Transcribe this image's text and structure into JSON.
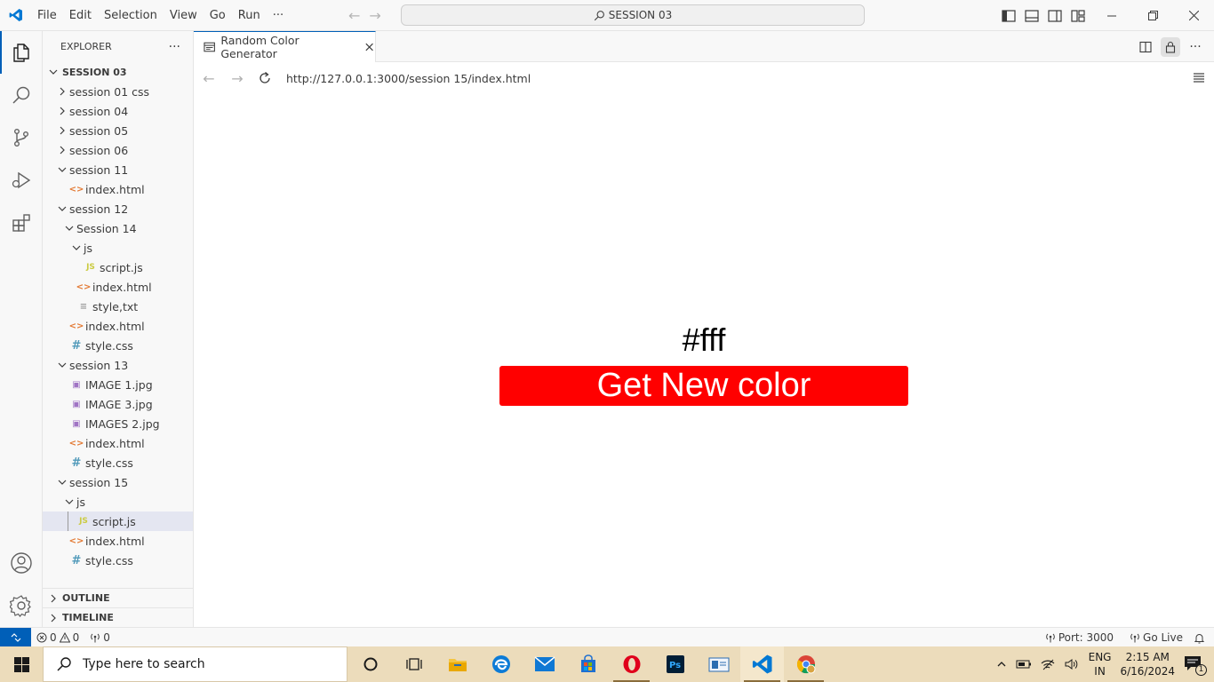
{
  "titlebar": {
    "menu": [
      "File",
      "Edit",
      "Selection",
      "View",
      "Go",
      "Run",
      "···"
    ],
    "command_center": "SESSION 03"
  },
  "sidebar": {
    "title": "EXPLORER",
    "more": "···",
    "section": "SESSION 03",
    "tree": [
      {
        "label": "session  01 css",
        "type": "folder",
        "depth": 0,
        "expanded": false
      },
      {
        "label": "session 04",
        "type": "folder",
        "depth": 0,
        "expanded": false
      },
      {
        "label": "session 05",
        "type": "folder",
        "depth": 0,
        "expanded": false
      },
      {
        "label": "session 06",
        "type": "folder",
        "depth": 0,
        "expanded": false
      },
      {
        "label": "session 11",
        "type": "folder",
        "depth": 0,
        "expanded": true
      },
      {
        "label": "index.html",
        "type": "html",
        "depth": 1
      },
      {
        "label": "session 12",
        "type": "folder",
        "depth": 0,
        "expanded": true
      },
      {
        "label": "Session 14",
        "type": "folder",
        "depth": 1,
        "expanded": true
      },
      {
        "label": "js",
        "type": "folder",
        "depth": 2,
        "expanded": true
      },
      {
        "label": "script.js",
        "type": "js",
        "depth": 3
      },
      {
        "label": "index.html",
        "type": "html",
        "depth": 2
      },
      {
        "label": "style,txt",
        "type": "txt",
        "depth": 2
      },
      {
        "label": "index.html",
        "type": "html",
        "depth": 1
      },
      {
        "label": "style.css",
        "type": "css",
        "depth": 1
      },
      {
        "label": "session 13",
        "type": "folder",
        "depth": 0,
        "expanded": true
      },
      {
        "label": "IMAGE 1.jpg",
        "type": "img",
        "depth": 1
      },
      {
        "label": "IMAGE 3.jpg",
        "type": "img",
        "depth": 1
      },
      {
        "label": "IMAGES 2.jpg",
        "type": "img",
        "depth": 1
      },
      {
        "label": "index.html",
        "type": "html",
        "depth": 1
      },
      {
        "label": "style.css",
        "type": "css",
        "depth": 1
      },
      {
        "label": "session 15",
        "type": "folder",
        "depth": 0,
        "expanded": true
      },
      {
        "label": "js",
        "type": "folder",
        "depth": 1,
        "expanded": true
      },
      {
        "label": "script.js",
        "type": "js",
        "depth": 2,
        "selected": true
      },
      {
        "label": "index.html",
        "type": "html",
        "depth": 1
      },
      {
        "label": "style.css",
        "type": "css",
        "depth": 1
      }
    ],
    "outline": "OUTLINE",
    "timeline": "TIMELINE"
  },
  "editor": {
    "tab_label": "Random Color Generator",
    "url": "http://127.0.0.1:3000/session 15/index.html",
    "page": {
      "color_code": "#fff",
      "button_label": "Get New color",
      "button_color": "#ff0000"
    }
  },
  "statusbar": {
    "errors": "0",
    "warnings": "0",
    "ports": "0",
    "port": "Port: 3000",
    "go_live": "Go Live"
  },
  "taskbar": {
    "search_placeholder": "Type here to search",
    "lang_top": "ENG",
    "lang_bottom": "IN",
    "time": "2:15 AM",
    "date": "6/16/2024",
    "notification_count": "1"
  },
  "colors": {
    "accent": "#005fb8",
    "button_red": "#ff0000",
    "taskbar_bg": "#ecdcbb"
  }
}
